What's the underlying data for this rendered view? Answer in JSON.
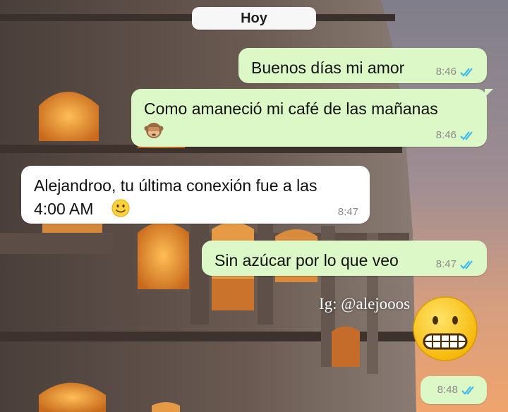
{
  "date_separator": "Hoy",
  "messages": [
    {
      "direction": "out",
      "text": "Buenos días mi amor",
      "time": "8:46",
      "status": "read"
    },
    {
      "direction": "out",
      "text": "Como amaneció mi café de las mañanas",
      "emoji": "see-no-evil-monkey",
      "time": "8:46",
      "status": "read"
    },
    {
      "direction": "in",
      "text_line1": "Alejandroo, tu última conexión fue a las",
      "text_line2": "4:00 AM",
      "emoji": "slightly-smiling-face",
      "time": "8:47"
    },
    {
      "direction": "out",
      "text": "Sin azúcar por lo que veo",
      "time": "8:47",
      "status": "read"
    },
    {
      "direction": "out",
      "text": "",
      "time": "8:48",
      "status": "read"
    }
  ],
  "watermark": "Ig: @alejooos",
  "sticker_emoji": "grimacing-face",
  "colors": {
    "outgoing_bubble": "#dcf8c6",
    "incoming_bubble": "#ffffff",
    "read_ticks": "#34b7f1"
  }
}
